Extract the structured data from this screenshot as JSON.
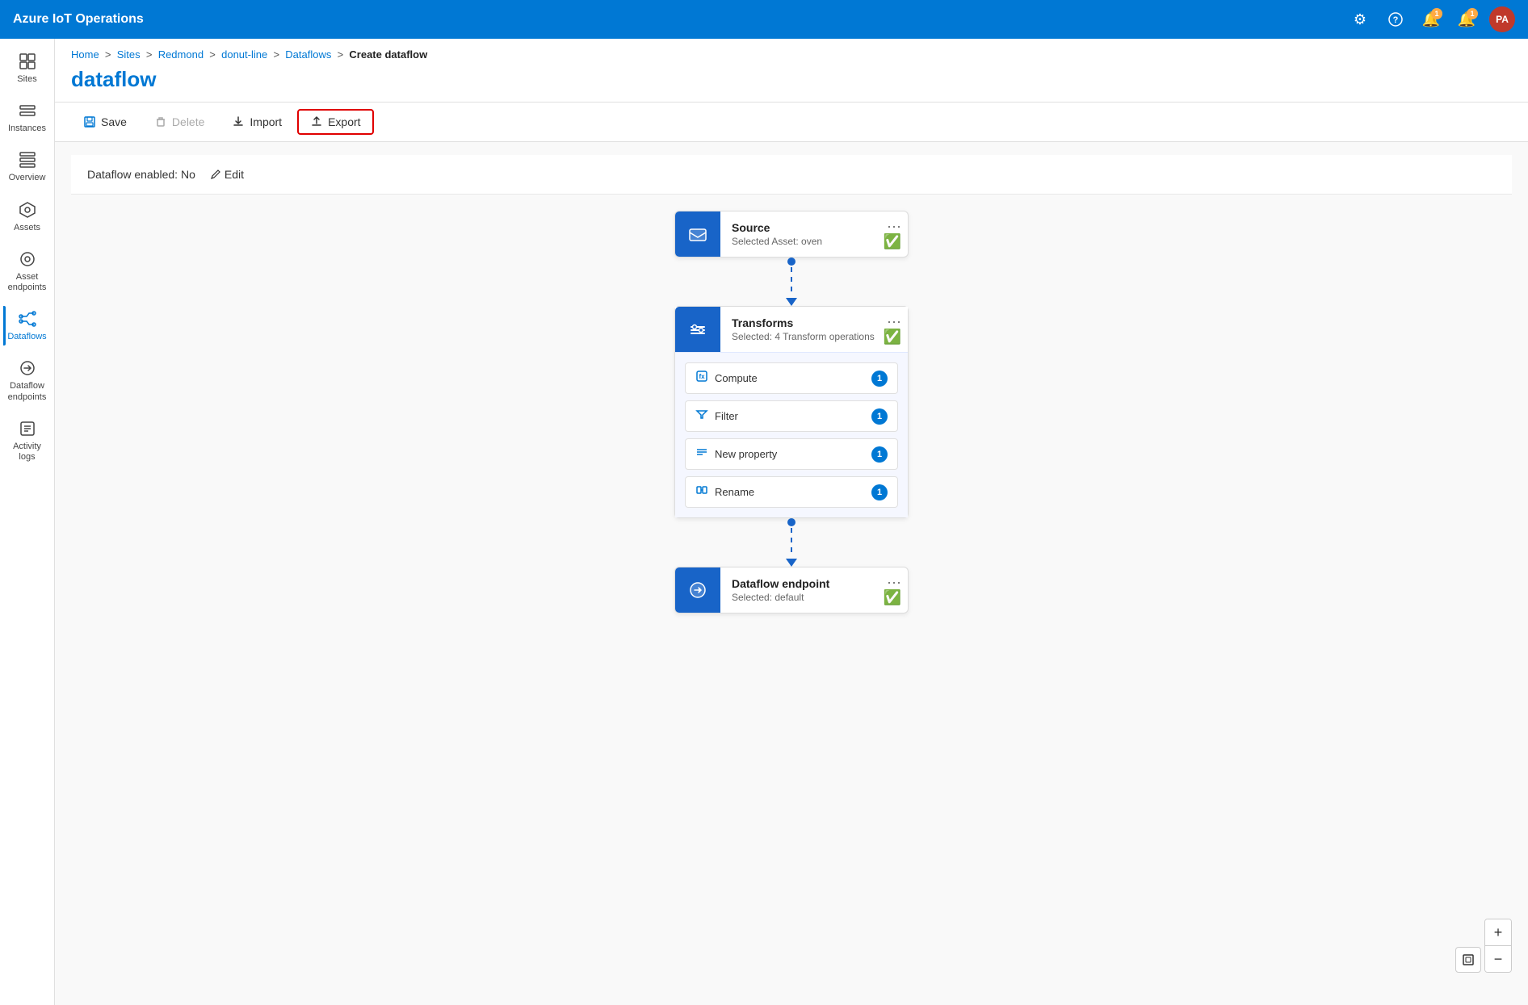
{
  "app": {
    "title": "Azure IoT Operations"
  },
  "topbar": {
    "icons": {
      "settings": "⚙",
      "help": "?",
      "notifications1": "🔔",
      "notifications2": "🔔",
      "avatar": "PA"
    },
    "badge1": "1",
    "badge2": "1"
  },
  "sidebar": {
    "items": [
      {
        "id": "sites",
        "label": "Sites",
        "icon": "⊞"
      },
      {
        "id": "instances",
        "label": "Instances",
        "icon": "⊟"
      },
      {
        "id": "overview",
        "label": "Overview",
        "icon": "▤"
      },
      {
        "id": "assets",
        "label": "Assets",
        "icon": "◈"
      },
      {
        "id": "asset-endpoints",
        "label": "Asset endpoints",
        "icon": "⬡"
      },
      {
        "id": "dataflows",
        "label": "Dataflows",
        "icon": "⇄",
        "active": true
      },
      {
        "id": "dataflow-endpoints",
        "label": "Dataflow endpoints",
        "icon": "⬡"
      },
      {
        "id": "activity-logs",
        "label": "Activity logs",
        "icon": "≡"
      }
    ]
  },
  "breadcrumb": {
    "parts": [
      "Home",
      "Sites",
      "Redmond",
      "donut-line",
      "Dataflows"
    ],
    "current": "Create dataflow"
  },
  "page": {
    "title": "dataflow"
  },
  "toolbar": {
    "save": "Save",
    "delete": "Delete",
    "import": "Import",
    "export": "Export"
  },
  "status": {
    "label": "Dataflow enabled: No",
    "edit": "Edit"
  },
  "nodes": {
    "source": {
      "title": "Source",
      "subtitle": "Selected Asset: oven",
      "menu": "···"
    },
    "transforms": {
      "title": "Transforms",
      "subtitle": "Selected: 4 Transform operations",
      "menu": "···",
      "items": [
        {
          "id": "compute",
          "label": "Compute",
          "count": "1"
        },
        {
          "id": "filter",
          "label": "Filter",
          "count": "1"
        },
        {
          "id": "new-property",
          "label": "New property",
          "count": "1"
        },
        {
          "id": "rename",
          "label": "Rename",
          "count": "1"
        }
      ]
    },
    "endpoint": {
      "title": "Dataflow endpoint",
      "subtitle": "Selected: default",
      "menu": "···"
    }
  },
  "zoom": {
    "plus": "+",
    "minus": "−",
    "frame": "⊡"
  }
}
